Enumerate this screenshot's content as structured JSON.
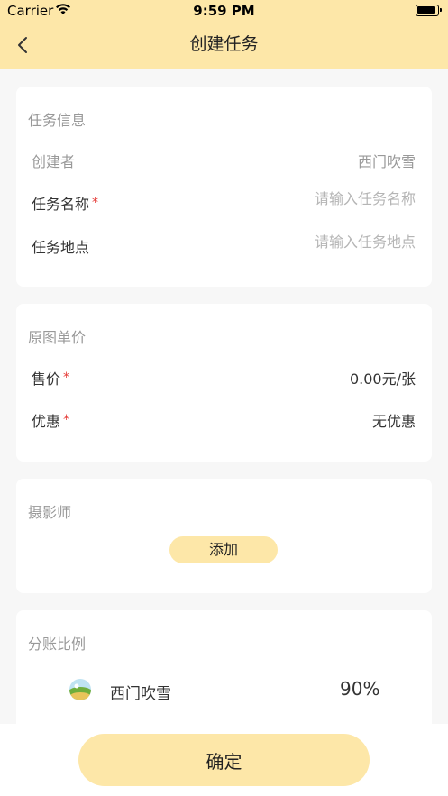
{
  "status_bar": {
    "carrier": "Carrier",
    "time": "9:59 PM"
  },
  "nav": {
    "title": "创建任务",
    "back_icon": "chevron-left-icon"
  },
  "task_info": {
    "title": "任务信息",
    "creator_label": "创建者",
    "creator_value": "西门吹雪",
    "name_label": "任务名称",
    "name_required": "*",
    "name_placeholder": "请输入任务名称",
    "location_label": "任务地点",
    "location_placeholder": "请输入任务地点"
  },
  "price": {
    "title": "原图单价",
    "sale_label": "售价",
    "sale_required": "*",
    "sale_value": "0.00元/张",
    "discount_label": "优惠",
    "discount_required": "*",
    "discount_value": "无优惠"
  },
  "photographer": {
    "title": "摄影师",
    "add_label": "添加"
  },
  "split": {
    "title": "分账比例",
    "rows": [
      {
        "name": "西门吹雪",
        "percent": "90%"
      }
    ]
  },
  "footer": {
    "confirm_label": "确定"
  },
  "colors": {
    "accent": "#fde7a8",
    "required": "#e53935",
    "background": "#f7f7f7"
  }
}
